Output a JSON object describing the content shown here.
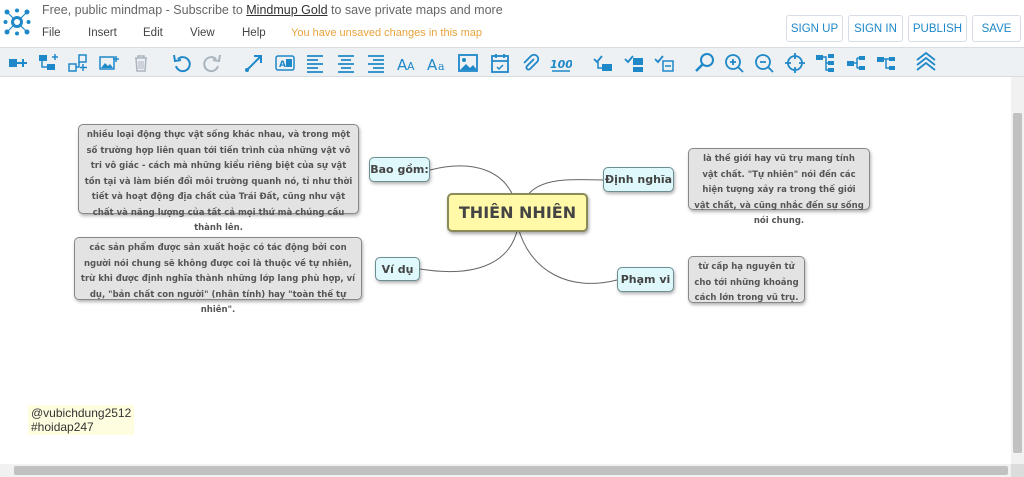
{
  "header": {
    "promo_prefix": "Free, public mindmap - Subscribe to ",
    "promo_link": "Mindmup Gold",
    "promo_suffix": " to save private maps and more",
    "menu": [
      "File",
      "Insert",
      "Edit",
      "View",
      "Help"
    ],
    "unsaved_notice": "You have unsaved changes in this map",
    "buttons": {
      "sign_up": "SIGN UP",
      "sign_in": "SIGN IN",
      "publish": "PUBLISH",
      "save": "SAVE"
    }
  },
  "toolbar": {
    "icons": [
      "add-child-icon",
      "add-sibling-icon",
      "add-parent-icon",
      "insert-image-icon",
      "delete-icon",
      "undo-icon",
      "redo-icon",
      "connect-icon",
      "text-style-icon",
      "align-left-icon",
      "align-center-icon",
      "align-right-icon",
      "text-size-icon",
      "font-icon",
      "image-icon",
      "calendar-icon",
      "attachment-icon",
      "progress-icon",
      "expand-icon",
      "collapse-icon",
      "toggle-icon",
      "search-icon",
      "zoom-in-icon",
      "zoom-out-icon",
      "center-icon",
      "layout-top-down-icon",
      "layout-left-right-icon",
      "layout-standard-icon",
      "collapse-all-icon"
    ]
  },
  "mindmap": {
    "central": "THIÊN NHIÊN",
    "branches": {
      "bao_gom": "Bao gồm:",
      "dinh_nghia": "Định nghĩa",
      "vi_du": "Ví dụ",
      "pham_vi": "Phạm vi"
    },
    "leaves": {
      "bao_gom": "nhiều loại động thực vật sống khác nhau, và trong một số trường hợp liên quan tới tiến trình của những vật vô tri vô giác - cách mà những kiểu riêng biệt của sự vật tồn tại và làm biến đổi môi trường quanh nó, tỉ như thời tiết và hoạt động địa chất của Trái Đất, cũng như vật chất và năng lượng của tất cả mọi thứ mà chúng cấu thành lên.",
      "dinh_nghia": "là thế giới hay vũ trụ mang tính vật chất. \"Tự nhiên\" nói đến các hiện tượng xảy ra trong thế giới vật chất, và cũng nhắc đến sự sống nói chung.",
      "vi_du": "các sản phẩm được sản xuất hoặc có tác động bởi con người nói chung sẽ không được coi là thuộc về tự nhiên, trừ khi được định nghĩa thành những lớp lang phù hợp, ví dụ, \"bản chất con người\" (nhân tính) hay \"toàn thế tự nhiên\".",
      "pham_vi": "từ cấp hạ nguyên tử cho tới những khoảng cách lớn trong vũ trụ."
    }
  },
  "credit": {
    "line1": "@vubichdung2512",
    "line2": "#hoidap247"
  },
  "colors": {
    "accent": "#1e88c9",
    "unsaved": "#e8a33d",
    "central_fill": "#fff9a8",
    "branch_fill": "#dff8fb",
    "leaf_fill": "#e3e3e3"
  }
}
